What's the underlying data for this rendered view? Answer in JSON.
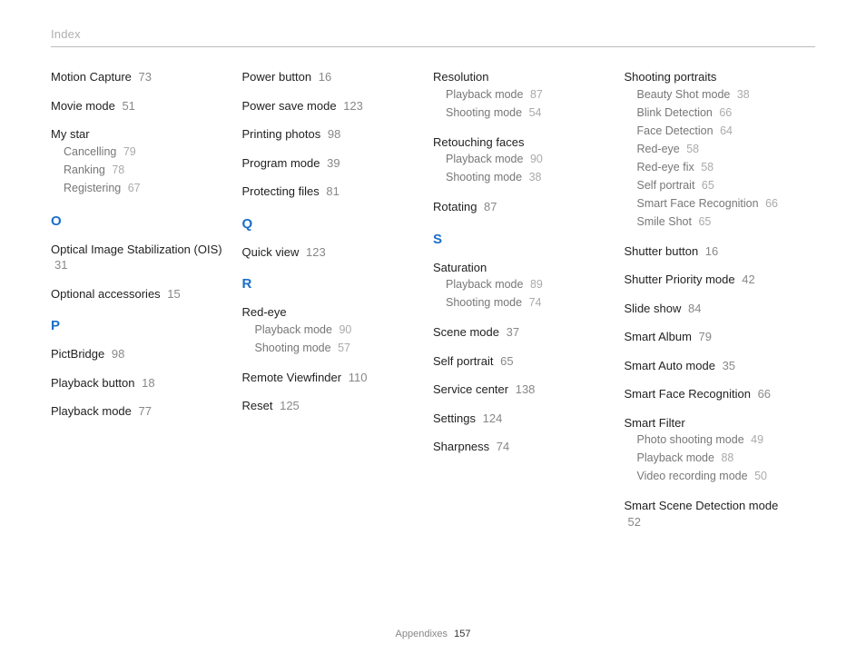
{
  "header": "Index",
  "footer": {
    "label": "Appendixes",
    "page": "157"
  },
  "columns": [
    {
      "items": [
        {
          "type": "entry",
          "label": "Motion Capture",
          "page": "73"
        },
        {
          "type": "entry",
          "label": "Movie mode",
          "page": "51"
        },
        {
          "type": "group",
          "label": "My star",
          "subs": [
            {
              "label": "Cancelling",
              "page": "79"
            },
            {
              "label": "Ranking",
              "page": "78"
            },
            {
              "label": "Registering",
              "page": "67"
            }
          ]
        },
        {
          "type": "letter",
          "label": "O"
        },
        {
          "type": "entry",
          "label": "Optical Image Stabilization (OIS)",
          "page": "31"
        },
        {
          "type": "entry",
          "label": "Optional accessories",
          "page": "15"
        },
        {
          "type": "letter",
          "label": "P"
        },
        {
          "type": "entry",
          "label": "PictBridge",
          "page": "98"
        },
        {
          "type": "entry",
          "label": "Playback button",
          "page": "18"
        },
        {
          "type": "entry",
          "label": "Playback mode",
          "page": "77"
        }
      ]
    },
    {
      "items": [
        {
          "type": "entry",
          "label": "Power button",
          "page": "16"
        },
        {
          "type": "entry",
          "label": "Power save mode",
          "page": "123"
        },
        {
          "type": "entry",
          "label": "Printing photos",
          "page": "98"
        },
        {
          "type": "entry",
          "label": "Program mode",
          "page": "39"
        },
        {
          "type": "entry",
          "label": "Protecting files",
          "page": "81"
        },
        {
          "type": "letter",
          "label": "Q"
        },
        {
          "type": "entry",
          "label": "Quick view",
          "page": "123"
        },
        {
          "type": "letter",
          "label": "R"
        },
        {
          "type": "group",
          "label": "Red-eye",
          "subs": [
            {
              "label": "Playback mode",
              "page": "90"
            },
            {
              "label": "Shooting mode",
              "page": "57"
            }
          ]
        },
        {
          "type": "entry",
          "label": "Remote Viewfinder",
          "page": "110"
        },
        {
          "type": "entry",
          "label": "Reset",
          "page": "125"
        }
      ]
    },
    {
      "items": [
        {
          "type": "group",
          "label": "Resolution",
          "subs": [
            {
              "label": "Playback mode",
              "page": "87"
            },
            {
              "label": "Shooting mode",
              "page": "54"
            }
          ]
        },
        {
          "type": "group",
          "label": "Retouching faces",
          "subs": [
            {
              "label": "Playback mode",
              "page": "90"
            },
            {
              "label": "Shooting mode",
              "page": "38"
            }
          ]
        },
        {
          "type": "entry",
          "label": "Rotating",
          "page": "87"
        },
        {
          "type": "letter",
          "label": "S"
        },
        {
          "type": "group",
          "label": "Saturation",
          "subs": [
            {
              "label": "Playback mode",
              "page": "89"
            },
            {
              "label": "Shooting mode",
              "page": "74"
            }
          ]
        },
        {
          "type": "entry",
          "label": "Scene mode",
          "page": "37"
        },
        {
          "type": "entry",
          "label": "Self portrait",
          "page": "65"
        },
        {
          "type": "entry",
          "label": "Service center",
          "page": "138"
        },
        {
          "type": "entry",
          "label": "Settings",
          "page": "124"
        },
        {
          "type": "entry",
          "label": "Sharpness",
          "page": "74"
        }
      ]
    },
    {
      "items": [
        {
          "type": "group",
          "label": "Shooting portraits",
          "subs": [
            {
              "label": "Beauty Shot mode",
              "page": "38"
            },
            {
              "label": "Blink Detection",
              "page": "66"
            },
            {
              "label": "Face Detection",
              "page": "64"
            },
            {
              "label": "Red-eye",
              "page": "58"
            },
            {
              "label": "Red-eye fix",
              "page": "58"
            },
            {
              "label": "Self portrait",
              "page": "65"
            },
            {
              "label": "Smart Face Recognition",
              "page": "66"
            },
            {
              "label": "Smile Shot",
              "page": "65"
            }
          ]
        },
        {
          "type": "entry",
          "label": "Shutter button",
          "page": "16"
        },
        {
          "type": "entry",
          "label": "Shutter Priority mode",
          "page": "42"
        },
        {
          "type": "entry",
          "label": "Slide show",
          "page": "84"
        },
        {
          "type": "entry",
          "label": "Smart Album",
          "page": "79"
        },
        {
          "type": "entry",
          "label": "Smart Auto mode",
          "page": "35"
        },
        {
          "type": "entry",
          "label": "Smart Face Recognition",
          "page": "66"
        },
        {
          "type": "group",
          "label": "Smart Filter",
          "subs": [
            {
              "label": "Photo shooting mode",
              "page": "49"
            },
            {
              "label": "Playback mode",
              "page": "88"
            },
            {
              "label": "Video recording mode",
              "page": "50"
            }
          ]
        },
        {
          "type": "entry",
          "label": "Smart Scene Detection mode",
          "page": "52"
        }
      ]
    }
  ]
}
